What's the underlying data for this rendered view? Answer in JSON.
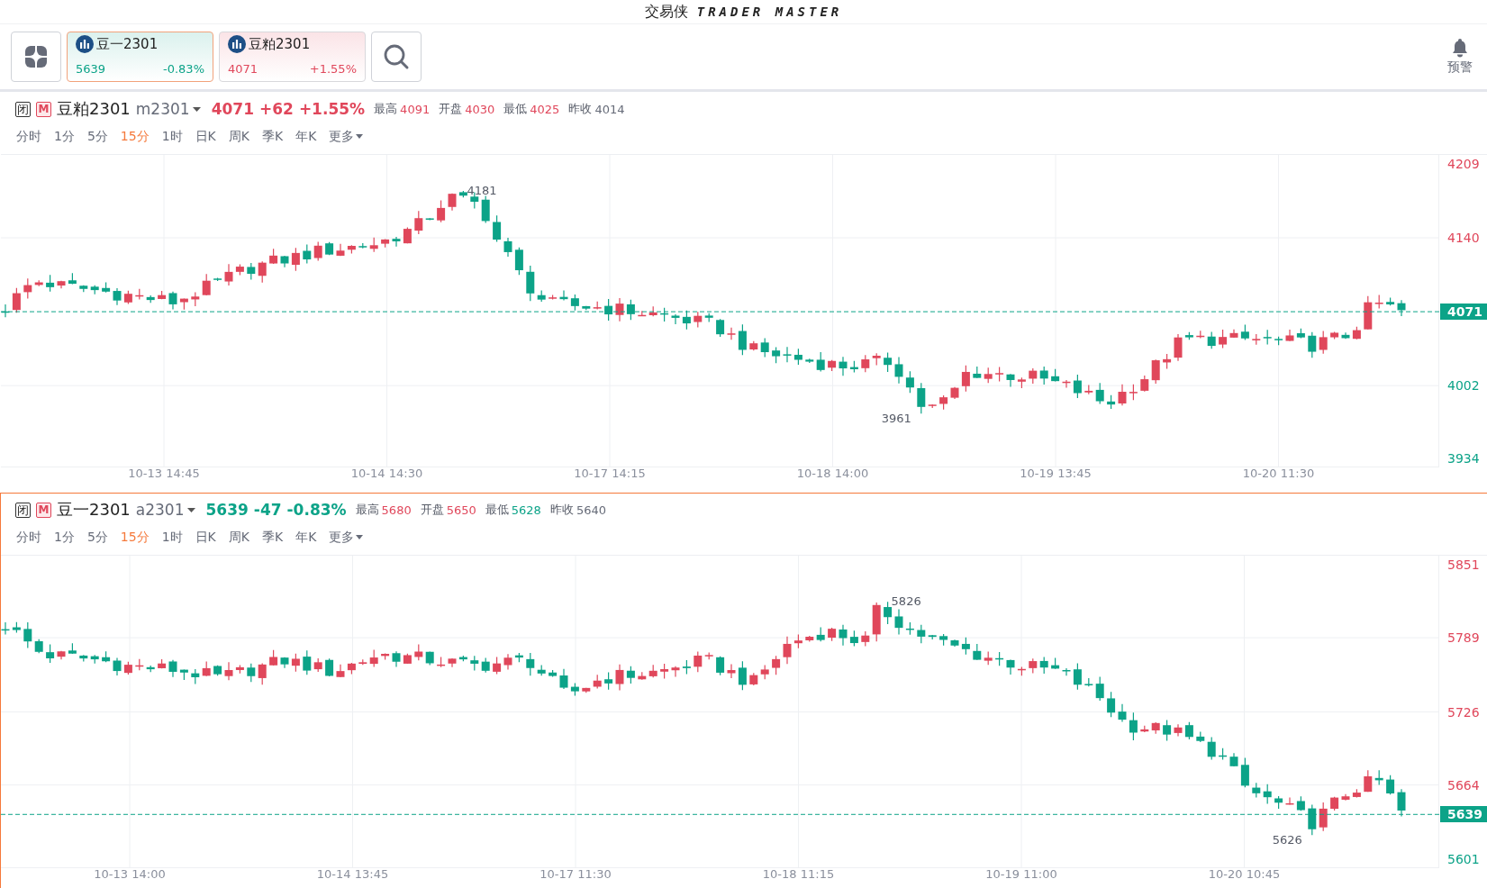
{
  "app_title": {
    "name": "交易侠",
    "subtitle": "TRADER MASTER"
  },
  "watchlist": [
    {
      "name": "豆一2301",
      "price": "5639",
      "change": "-0.83%",
      "color": "#0ca388",
      "selected": true
    },
    {
      "name": "豆粕2301",
      "price": "4071",
      "change": "+1.55%",
      "color": "#e0475b",
      "selected": false
    }
  ],
  "alert_button": {
    "label": "预警"
  },
  "panels": [
    {
      "selected": false,
      "status_badge": "闭",
      "market_badge": "M",
      "name": "豆粕2301",
      "code": "m2301",
      "price": "4071",
      "change": "+62",
      "change_pct": "+1.55%",
      "color": "#e0475b",
      "stats": [
        {
          "label": "最高",
          "value": "4091",
          "color": "#e0475b"
        },
        {
          "label": "开盘",
          "value": "4030",
          "color": "#e0475b"
        },
        {
          "label": "最低",
          "value": "4025",
          "color": "#e0475b"
        },
        {
          "label": "昨收",
          "value": "4014",
          "color": "#666b78"
        }
      ],
      "periods": [
        {
          "label": "分时",
          "selected": false
        },
        {
          "label": "1分",
          "selected": false
        },
        {
          "label": "5分",
          "selected": false
        },
        {
          "label": "15分",
          "selected": true
        },
        {
          "label": "1时",
          "selected": false
        },
        {
          "label": "日K",
          "selected": false
        },
        {
          "label": "周K",
          "selected": false
        },
        {
          "label": "季K",
          "selected": false
        },
        {
          "label": "年K",
          "selected": false
        },
        {
          "label": "更多",
          "selected": false,
          "kind": "menu"
        }
      ],
      "y_axis": [
        {
          "label": "4209",
          "color": "#e0475b"
        },
        {
          "label": "4140",
          "color": "#e0475b"
        },
        {
          "label": "4002",
          "color": "#0ca388"
        },
        {
          "label": "3934",
          "color": "#0ca388"
        }
      ],
      "x_axis": [
        "10-13 14:45",
        "10-14 14:30",
        "10-17 14:15",
        "10-18 14:00",
        "10-19 13:45",
        "10-20 11:30"
      ],
      "last_price": {
        "label": "4071"
      },
      "annotations": [
        {
          "label": "4181",
          "kind": "high"
        },
        {
          "label": "3961",
          "kind": "low"
        }
      ]
    },
    {
      "selected": true,
      "status_badge": "闭",
      "market_badge": "M",
      "name": "豆一2301",
      "code": "a2301",
      "price": "5639",
      "change": "-47",
      "change_pct": "-0.83%",
      "color": "#0ca388",
      "stats": [
        {
          "label": "最高",
          "value": "5680",
          "color": "#e0475b"
        },
        {
          "label": "开盘",
          "value": "5650",
          "color": "#e0475b"
        },
        {
          "label": "最低",
          "value": "5628",
          "color": "#0ca388"
        },
        {
          "label": "昨收",
          "value": "5640",
          "color": "#666b78"
        }
      ],
      "periods": [
        {
          "label": "分时",
          "selected": false
        },
        {
          "label": "1分",
          "selected": false
        },
        {
          "label": "5分",
          "selected": false
        },
        {
          "label": "15分",
          "selected": true
        },
        {
          "label": "1时",
          "selected": false
        },
        {
          "label": "日K",
          "selected": false
        },
        {
          "label": "周K",
          "selected": false
        },
        {
          "label": "季K",
          "selected": false
        },
        {
          "label": "年K",
          "selected": false
        },
        {
          "label": "更多",
          "selected": false,
          "kind": "menu"
        }
      ],
      "y_axis": [
        {
          "label": "5851",
          "color": "#e0475b"
        },
        {
          "label": "5789",
          "color": "#e0475b"
        },
        {
          "label": "5726",
          "color": "#e0475b"
        },
        {
          "label": "5664",
          "color": "#e0475b"
        },
        {
          "label": "5601",
          "color": "#0ca388"
        }
      ],
      "x_axis": [
        "10-13 14:00",
        "10-14 13:45",
        "10-17 11:30",
        "10-18 11:15",
        "10-19 11:00",
        "10-20 10:45"
      ],
      "last_price": {
        "label": "5639"
      },
      "annotations": [
        {
          "label": "5826",
          "kind": "high"
        },
        {
          "label": "5626",
          "kind": "low"
        }
      ]
    }
  ]
}
